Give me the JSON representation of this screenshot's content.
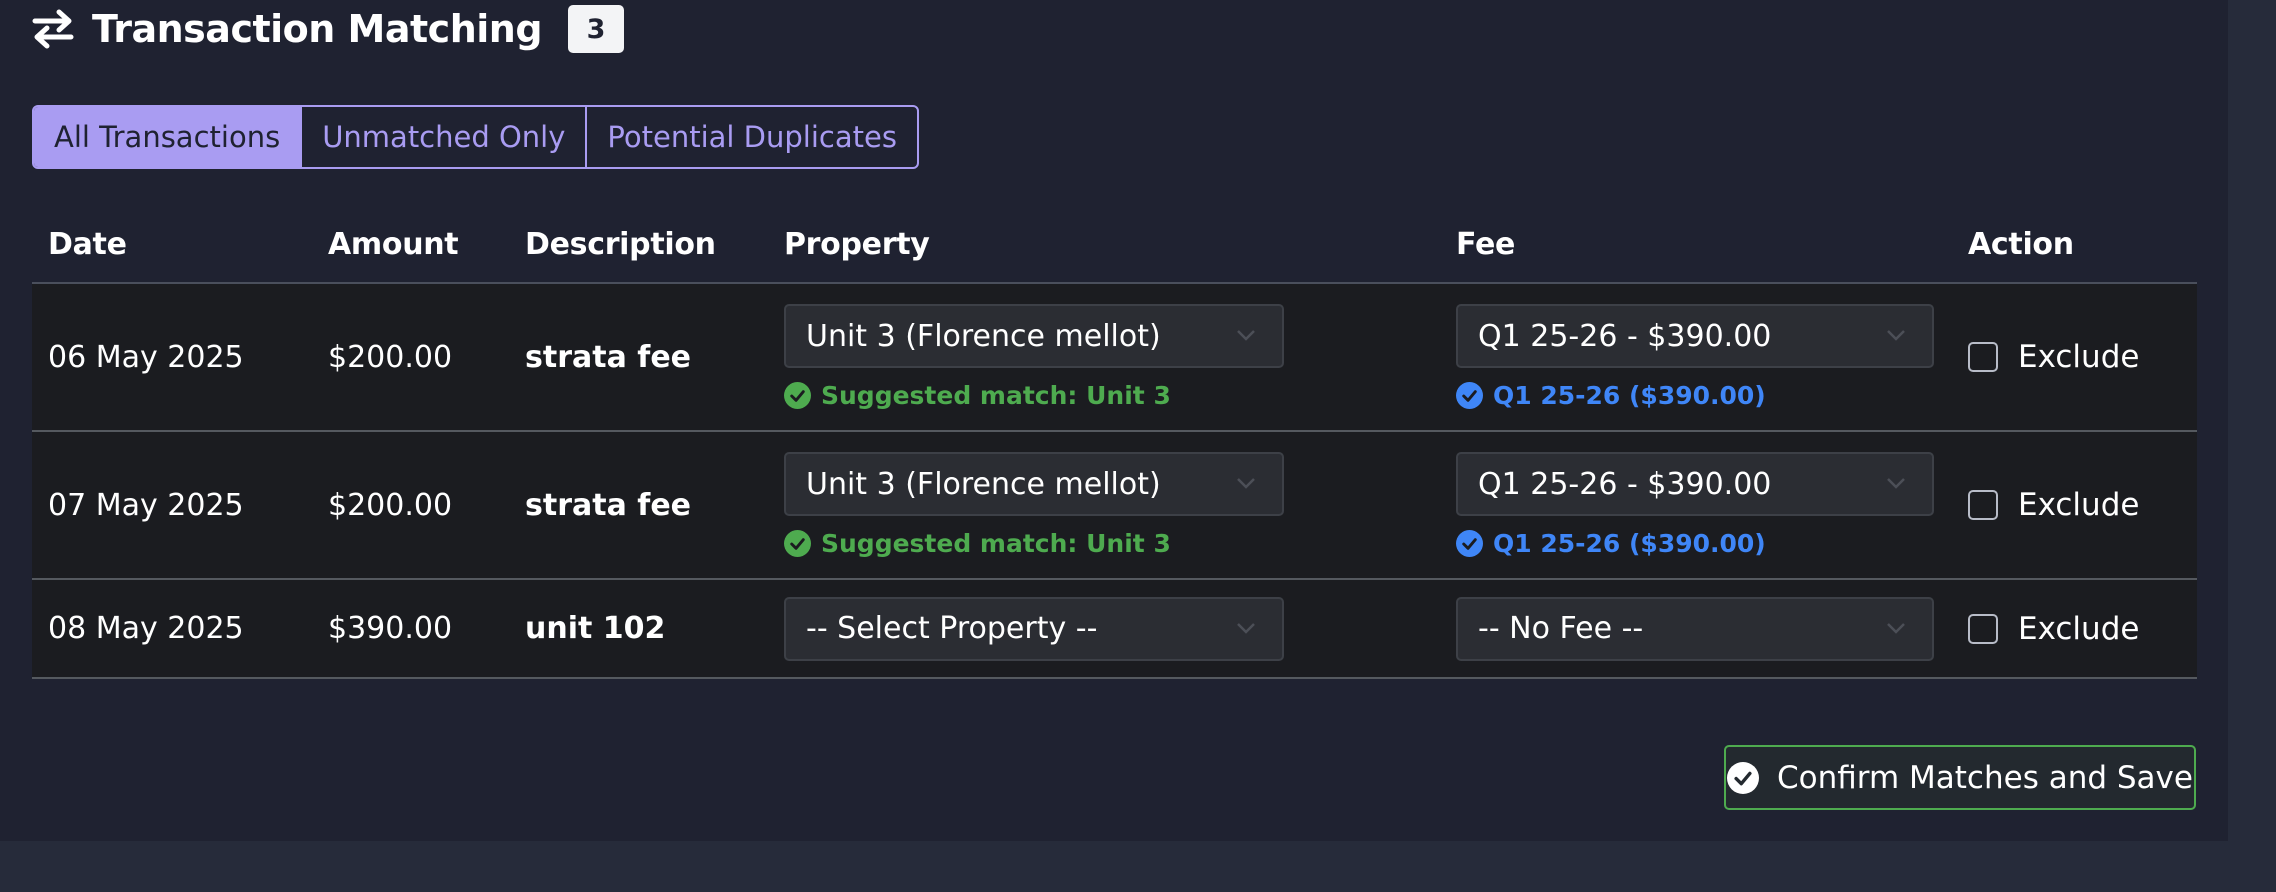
{
  "header": {
    "title": "Transaction Matching",
    "count": "3",
    "icon": "swap-arrows-icon"
  },
  "tabs": [
    {
      "label": "All Transactions",
      "active": true
    },
    {
      "label": "Unmatched Only",
      "active": false
    },
    {
      "label": "Potential Duplicates",
      "active": false
    }
  ],
  "table": {
    "columns": [
      "Date",
      "Amount",
      "Description",
      "Property",
      "Fee",
      "Action"
    ],
    "rows": [
      {
        "date": "06 May 2025",
        "amount": "$200.00",
        "description": "strata fee",
        "property": "Unit 3 (Florence mellot)",
        "property_hint": "Suggested match: Unit 3",
        "fee": "Q1 25-26 - $390.00",
        "fee_hint": "Q1 25-26 ($390.00)",
        "exclude_label": "Exclude",
        "excluded": false
      },
      {
        "date": "07 May 2025",
        "amount": "$200.00",
        "description": "strata fee",
        "property": "Unit 3 (Florence mellot)",
        "property_hint": "Suggested match: Unit 3",
        "fee": "Q1 25-26 - $390.00",
        "fee_hint": "Q1 25-26 ($390.00)",
        "exclude_label": "Exclude",
        "excluded": false
      },
      {
        "date": "08 May 2025",
        "amount": "$390.00",
        "description": "unit 102",
        "property": "-- Select Property --",
        "fee": "-- No Fee --",
        "exclude_label": "Exclude",
        "excluded": false
      }
    ]
  },
  "confirm_button": {
    "label": "Confirm Matches and Save",
    "icon": "check-circle-icon"
  },
  "colors": {
    "accent": "#a99cf2",
    "success": "#4eab4f",
    "info": "#3f86f7",
    "panel_bg": "#1f2231",
    "row_bg": "#1b1c20"
  }
}
